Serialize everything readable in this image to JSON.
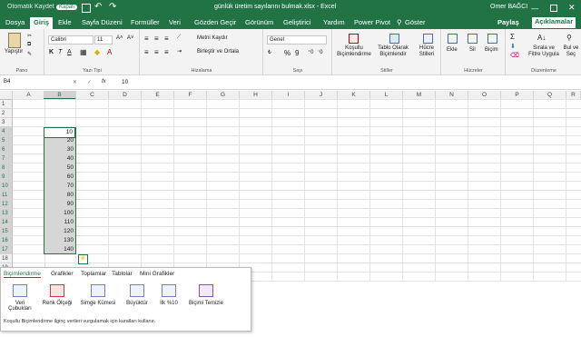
{
  "titlebar": {
    "autosave": "Otomatik Kaydet",
    "autosave_state": "Kapalı",
    "doc_title": "günlük üretim sayılarını bulmak.xlsx  -  Excel",
    "user": "Omer BAĞCI"
  },
  "tabs": [
    "Dosya",
    "Giriş",
    "Ekle",
    "Sayfa Düzeni",
    "Formüller",
    "Veri",
    "Gözden Geçir",
    "Görünüm",
    "Geliştirici",
    "Yardım",
    "Power Pivot"
  ],
  "tell_me": "Göster",
  "share": "Paylaş",
  "comments": "Açıklamalar",
  "ribbon": {
    "pano": {
      "label": "Pano",
      "paste": "Yapıştır"
    },
    "font": {
      "label": "Yazı Tipi",
      "name": "Calibri",
      "size": "11",
      "bold": "K",
      "italic": "T",
      "underline": "A"
    },
    "align": {
      "label": "Hizalama",
      "wrap": "Metni Kaydır",
      "merge": "Birleştir ve Ortala"
    },
    "number": {
      "label": "Sayı",
      "format": "Genel",
      "percent": "%",
      "thousands": "9"
    },
    "styles": {
      "label": "Stiller",
      "cond": "Koşullu Biçimlendirme",
      "table": "Tablo Olarak Biçimlendir",
      "cell": "Hücre Stilleri"
    },
    "cells": {
      "label": "Hücreler",
      "insert": "Ekle",
      "delete": "Sil",
      "format": "Biçim"
    },
    "editing": {
      "label": "Düzenleme",
      "sort": "Sırala ve Filtre Uygula",
      "find": "Bul ve Seç"
    }
  },
  "formula_bar": {
    "name_box": "B4",
    "fx": "fx",
    "value": "10"
  },
  "columns": [
    "A",
    "B",
    "C",
    "D",
    "E",
    "F",
    "G",
    "H",
    "I",
    "J",
    "K",
    "L",
    "M",
    "N",
    "O",
    "P",
    "Q",
    "R"
  ],
  "rows": [
    "1",
    "2",
    "3",
    "4",
    "5",
    "6",
    "7",
    "8",
    "9",
    "10",
    "11",
    "12",
    "13",
    "14",
    "15",
    "16",
    "17",
    "18",
    "19",
    "20"
  ],
  "cells_b": [
    "10",
    "20",
    "30",
    "40",
    "50",
    "60",
    "70",
    "80",
    "90",
    "100",
    "110",
    "120",
    "130",
    "140"
  ],
  "quick_analysis": {
    "tabs": [
      "Biçimlendirme",
      "Grafikler",
      "Toplamlar",
      "Tablolar",
      "Mini Grafikler"
    ],
    "items": [
      "Veri Çubukları",
      "Renk Ölçeği",
      "Simge Kümesi",
      "Büyüktür",
      "İlk %10",
      "Biçimi Temizle"
    ],
    "description": "Koşullu Biçimlendirme ilginç verileri vurgulamak için kuralları kullanır."
  },
  "colors": {
    "accent": "#217346",
    "selection": "#d6d6d6"
  }
}
